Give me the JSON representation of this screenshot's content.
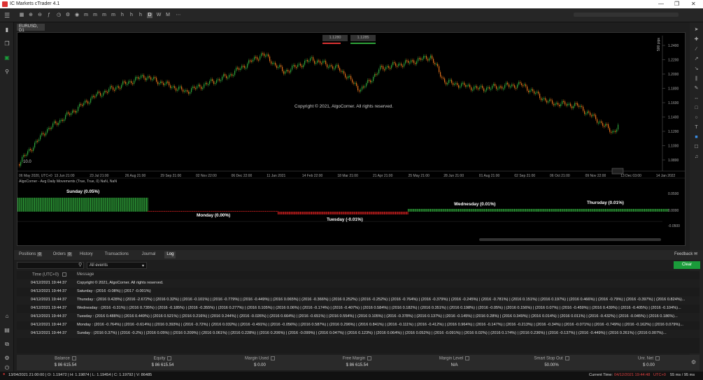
{
  "window": {
    "title": "IC Markets cTrader 4.1"
  },
  "chart": {
    "tab_label": "EURUSD, D1",
    "price_box_1": "1.1280",
    "price_box_2": "1.1285",
    "zoom_label": "500 pips",
    "copyright": "Copyright © 2021, AlgoCorner. All rights reserved.",
    "corner_value": "10.0",
    "y_labels": [
      "1.2400",
      "1.2200",
      "1.2000",
      "1.1800",
      "1.1600",
      "1.1400",
      "1.1200",
      "1.1000",
      "1.0800"
    ],
    "x_labels": [
      "06 May 2020, UTC+0",
      "13 Jun 21:00",
      "23 Jul 21:00",
      "26 Aug 21:00",
      "29 Sep 21:00",
      "02 Nov 22:00",
      "06 Dec 22:00",
      "11 Jan 2021",
      "14 Feb 22:00",
      "18 Mar 21:00",
      "21 Apr 21:00",
      "25 May 21:00",
      "28 Jun 21:00",
      "01 Aug 21:00",
      "02 Sep 21:00",
      "06 Oct 21:00",
      "09 Nov 22:00",
      "13 Dec 03:00",
      "14 Jan 2022"
    ],
    "indicator_title": "AlgoCorner - Avg Daily Movements (True, True, 0) NaN, NaN",
    "indicator_y_labels": [
      "0.0500",
      "0.0000",
      "-0.0500"
    ],
    "days": [
      {
        "label": "Sunday (0.05%)",
        "color": "#2fa33a",
        "start": 0.0,
        "end": 0.2,
        "value": 0.05
      },
      {
        "label": "Monday (0.00%)",
        "color": "#d02020",
        "start": 0.2,
        "end": 0.4,
        "value": 0.0
      },
      {
        "label": "Tuesday (-0.01%)",
        "color": "#d02020",
        "start": 0.4,
        "end": 0.6,
        "value": -0.01
      },
      {
        "label": "Wednesday (0.01%)",
        "color": "#2fa33a",
        "start": 0.6,
        "end": 0.8,
        "value": 0.01
      },
      {
        "label": "Thursday (0.01%)",
        "color": "#2fa33a",
        "start": 0.8,
        "end": 1.0,
        "value": 0.01
      }
    ],
    "colors": {
      "up": "#2fa33a",
      "down": "#e0701a",
      "accent": "#1a9c3a"
    }
  },
  "panel": {
    "tabs": [
      {
        "label": "Positions",
        "count": "0"
      },
      {
        "label": "Orders",
        "count": "0"
      },
      {
        "label": "History",
        "count": ""
      },
      {
        "label": "Transactions",
        "count": ""
      },
      {
        "label": "Journal",
        "count": ""
      },
      {
        "label": "Log",
        "count": ""
      }
    ],
    "feedback": "Feedback",
    "filter_value": "All events",
    "clear_label": "Clear",
    "col_time": "Time (UTC+0)",
    "col_message": "Message",
    "rows": [
      {
        "time": "04/12/2021 19:44:37",
        "message": "Copyright © 2021, AlgoCorner. All rights reserved."
      },
      {
        "time": "04/12/2021 19:44:37",
        "message": "Saturday : (2016 -0.08%) | (2017 -0.001%)"
      },
      {
        "time": "04/12/2021 19:44:37",
        "message": "Thursday : (2016 0.428%) | (2016 -2.672%) | (2016 0.32%) | (2016 -0.101%) | (2016 -0.779%) | (2016 -0.449%) | (2016 0.065%) | (2016 -0.366%) | (2016 0.252%) | (2016 -0.252%) | (2016 -0.764%) | (2016 -0.379%) | (2016 -0.245%) | (2016 -0.781%) | (2016 0.151%) | (2016 0.197%) | (2016 0.466%) | (2016 -0.79%) | (2016 -0.397%) | (2016 0.824%)..."
      },
      {
        "time": "04/12/2021 19:44:37",
        "message": "Wednesday : (2016 -0.31%) | (2016 0.735%) | (2016 -0.185%) | (2016 -0.355%) | (2016 0.277%) | (2016 0.105%) | (2016 0.06%) | (2016 -0.174%) | (2016 -0.407%) | (2016 0.584%) | (2016 0.182%) | (2016 0.351%) | (2016 0.198%) | (2016 -0.05%) | (2016 0.156%) | (2016 0.07%) | (2016 -0.459%) | (2016 0.439%) | (2016 -0.405%) | (2016 -0.104%)..."
      },
      {
        "time": "04/12/2021 19:44:37",
        "message": "Tuesday : (2016 0.488%) | (2016 0.449%) | (2016 0.521%) | (2016 0.216%) | (2016 0.244%) | (2016 -0.026%) | (2016 0.664%) | (2016 -0.651%) | (2016 0.554%) | (2016 0.105%) | (2016 -0.378%) | (2016 0.137%) | (2016 -0.145%) | (2016 0.28%) | (2016 0.349%) | (2016 0.014%) | (2016 0.011%) | (2016 -0.432%) | (2016 -0.045%) | (2016 0.186%)..."
      },
      {
        "time": "04/12/2021 19:44:37",
        "message": "Monday : (2016 -0.764%) | (2016 -0.614%) | (2016 0.393%) | (2016 -0.72%) | (2016 0.032%) | (2016 -0.491%) | (2016 -0.056%) | (2016 0.587%) | (2016 0.296%) | (2016 0.841%) | (2016 -0.111%) | (2016 -0.412%) | (2016 0.964%) | (2016 -0.147%) | (2016 -0.213%) | (2016 -0.34%) | (2016 -0.071%) | (2016 -0.749%) | (2016 -0.162%) | (2016 0.079%)..."
      },
      {
        "time": "04/12/2021 19:44:37",
        "message": "Sunday : (2016 0.37%) | (2016 -0.2%) | (2016 0.05%) | (2016 0.209%) | (2016 0.061%) | (2016 0.228%) | (2016 0.206%) | (2016 -0.099%) | (2016 0.047%) | (2016 0.123%) | (2016 0.064%) | (2016 0.052%) | (2016 -0.091%) | (2016 0.02%) | (2016 0.174%) | (2016 0.236%) | (2016 -0.137%) | (2016 -0.449%) | (2016 0.261%) | (2016 0.007%)..."
      }
    ]
  },
  "stats": [
    {
      "label": "Balance",
      "value": "$ 86 615.54"
    },
    {
      "label": "Equity",
      "value": "$ 86 615.54"
    },
    {
      "label": "Margin Used",
      "value": "$ 0.00"
    },
    {
      "label": "Free Margin",
      "value": "$ 86 615.54"
    },
    {
      "label": "Margin Level",
      "value": "N/A"
    },
    {
      "label": "Smart Stop Out",
      "value": "50.00%"
    },
    {
      "label": "Unr. Net",
      "value": "$ 0.00"
    }
  ],
  "status": {
    "ohlc": "13/04/2021 21:00:00 | O: 1.19472 | H: 1.19874 | L: 1.19454 | C: 1.19792 | V: 86485",
    "current_time_label": "Current Time:",
    "current_time": "04/12/2021 19:44:48",
    "tz": "UTC+0",
    "latency": "55 ms / 95 ms"
  }
}
